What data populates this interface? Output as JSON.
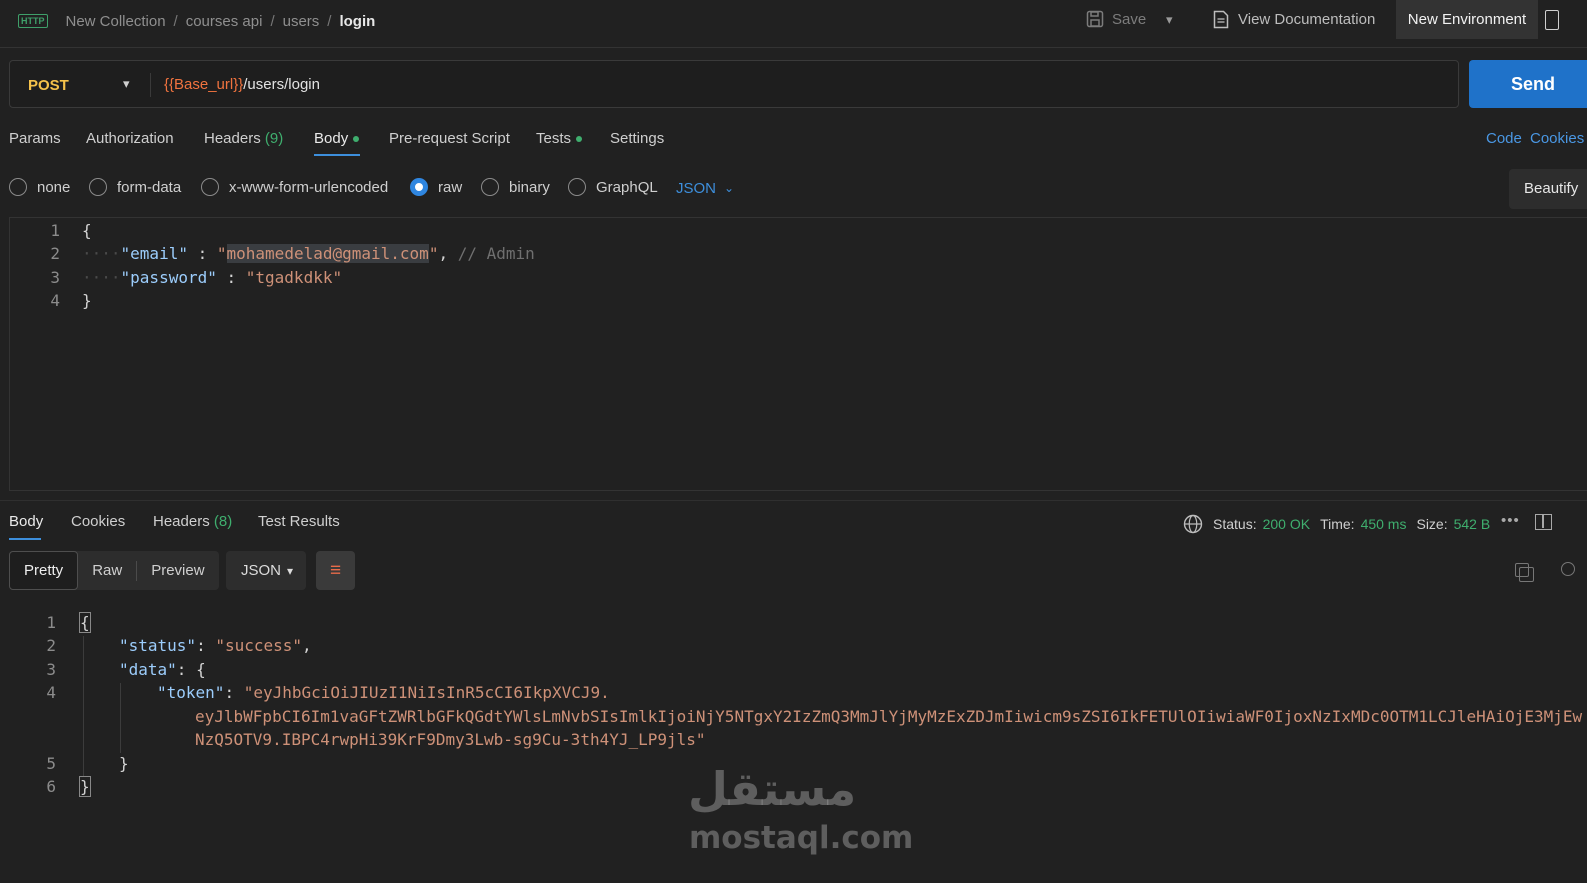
{
  "breadcrumb": {
    "protocol_badge": "HTTP",
    "collection": "New Collection",
    "folder1": "courses api",
    "folder2": "users",
    "current": "login",
    "separator": "/"
  },
  "toolbar": {
    "save_label": "Save",
    "view_doc_label": "View Documentation",
    "environment_label": "New Environment"
  },
  "request": {
    "method": "POST",
    "url_variable": "{{Base_url}}",
    "url_path": "/users/login",
    "send_label": "Send"
  },
  "request_tabs": {
    "params": "Params",
    "authorization": "Authorization",
    "headers": "Headers",
    "headers_count": "(9)",
    "body": "Body",
    "prerequest": "Pre-request Script",
    "tests": "Tests",
    "settings": "Settings",
    "code": "Code",
    "cookies": "Cookies"
  },
  "body_types": {
    "none": "none",
    "form_data": "form-data",
    "urlencoded": "x-www-form-urlencoded",
    "raw": "raw",
    "binary": "binary",
    "graphql": "GraphQL",
    "selected": "raw",
    "raw_format": "JSON",
    "beautify": "Beautify"
  },
  "request_body": {
    "line_numbers": [
      "1",
      "2",
      "3",
      "4"
    ],
    "open_brace": "{",
    "email_key": "\"email\"",
    "colon": " : ",
    "email_value_open": "\"",
    "email_value": "mohamedelad@gmail.com",
    "email_value_close": "\"",
    "comma": ",",
    "comment": "// Admin",
    "password_key": "\"password\"",
    "password_value": "\"tgadkdkk\"",
    "close_brace": "}",
    "indent_dots": "····"
  },
  "response_tabs": {
    "body": "Body",
    "cookies": "Cookies",
    "headers": "Headers",
    "headers_count": "(8)",
    "test_results": "Test Results"
  },
  "response_meta": {
    "status_label": "Status:",
    "status_value": "200 OK",
    "time_label": "Time:",
    "time_value": "450 ms",
    "size_label": "Size:",
    "size_value": "542 B",
    "more": "•••"
  },
  "response_view": {
    "pretty": "Pretty",
    "raw": "Raw",
    "preview": "Preview",
    "format": "JSON",
    "wrap_glyph": "≡"
  },
  "response_body": {
    "line_numbers": [
      "1",
      "2",
      "3",
      "4",
      "5",
      "6"
    ],
    "open_brace": "{",
    "status_key": "\"status\"",
    "status_value": "\"success\"",
    "data_key": "\"data\"",
    "token_key": "\"token\"",
    "token_line1": "\"eyJhbGciOiJIUzI1NiIsInR5cCI6IkpXVCJ9.",
    "token_line2": "eyJlbWFpbCI6Im1vaGFtZWRlbGFkQGdtYWlsLmNvbSIsImlkIjoiNjY5NTgxY2IzZmQ3MmJlYjMyMzExZDJmIiwicm9sZSI6IkFETUlOIiwiaWF0IjoxNzIxMDc0OTM1LCJleHAiOjE3MjEw",
    "token_line3": "NzQ5OTV9.IBPC4rwpHi39KrF9Dmy3Lwb-sg9Cu-3th4YJ_LP9jls\"",
    "inner_close": "}",
    "close_brace": "}"
  },
  "watermark": {
    "arabic": "مستقل",
    "latin": "mostaql.com"
  },
  "colors": {
    "accent": "#1f72c9",
    "method": "#f5c24b",
    "variable": "#f0733f",
    "success": "#3fae6e"
  }
}
